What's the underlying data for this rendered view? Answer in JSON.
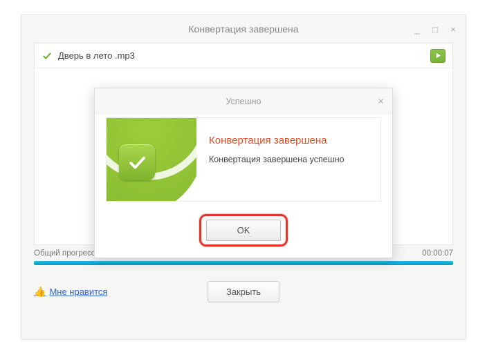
{
  "window": {
    "title": "Конвертация завершена",
    "minimize": "_",
    "maximize": "□",
    "close": "×"
  },
  "file": {
    "name": "Дверь в лето .mp3"
  },
  "progress": {
    "label": "Общий прогресс:",
    "value": "100%",
    "elapsed": "00:00:07"
  },
  "footer": {
    "like": "Мне нравится",
    "close": "Закрыть"
  },
  "modal": {
    "title": "Успешно",
    "heading": "Конвертация завершена",
    "message": "Конвертация завершена успешно",
    "ok": "OK",
    "close": "×"
  }
}
